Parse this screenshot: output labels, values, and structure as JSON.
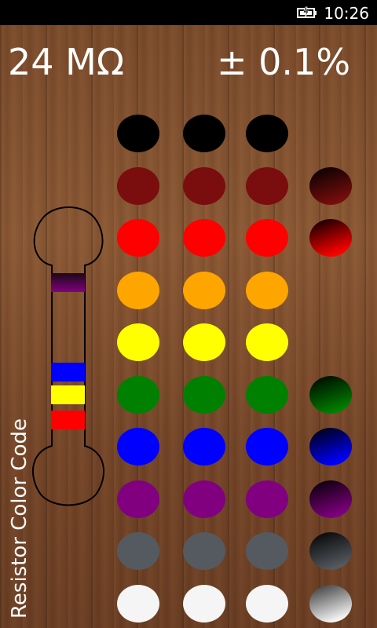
{
  "status_bar": {
    "time": "10:26",
    "battery_icon": "battery-charging-icon"
  },
  "value": "24 MΩ",
  "tolerance": "± 0.1%",
  "app_title": "Resistor Color Code",
  "colors": {
    "black": "#000000",
    "brown": "#7a0d0d",
    "red": "#ff0000",
    "orange": "#ffa500",
    "yellow": "#ffff00",
    "green": "#008000",
    "blue": "#0000ff",
    "violet": "#800080",
    "grey": "#555a60",
    "white": "#f5f5f5"
  },
  "resistor_bands": [
    "red",
    "yellow",
    "blue",
    "violet"
  ],
  "digit_columns": [
    [
      "black",
      "brown",
      "red",
      "orange",
      "yellow",
      "green",
      "blue",
      "violet",
      "grey",
      "white"
    ],
    [
      "black",
      "brown",
      "red",
      "orange",
      "yellow",
      "green",
      "blue",
      "violet",
      "grey",
      "white"
    ],
    [
      "black",
      "brown",
      "red",
      "orange",
      "yellow",
      "green",
      "blue",
      "violet",
      "grey",
      "white"
    ]
  ],
  "tolerance_column": [
    "brown",
    "red",
    "green",
    "blue",
    "violet",
    "grey",
    "white"
  ]
}
